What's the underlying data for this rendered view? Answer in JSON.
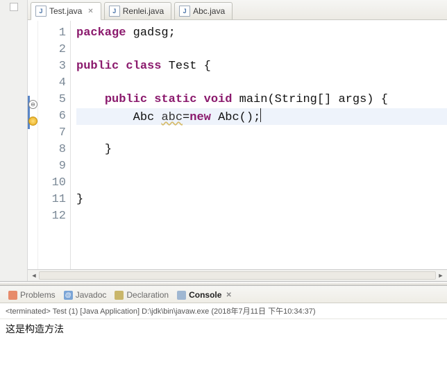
{
  "tabs": [
    {
      "label": "Test.java",
      "active": true,
      "closable": true
    },
    {
      "label": "Renlei.java",
      "active": false,
      "closable": false
    },
    {
      "label": "Abc.java",
      "active": false,
      "closable": false
    }
  ],
  "code": {
    "lines": [
      {
        "n": "1",
        "segments": [
          {
            "t": "package ",
            "c": "kw"
          },
          {
            "t": "gadsg;",
            "c": "plain"
          }
        ]
      },
      {
        "n": "2",
        "segments": []
      },
      {
        "n": "3",
        "segments": [
          {
            "t": "public class ",
            "c": "kw"
          },
          {
            "t": "Test {",
            "c": "plain"
          }
        ]
      },
      {
        "n": "4",
        "segments": []
      },
      {
        "n": "5",
        "prefix": "    ",
        "foldmark": true,
        "bluebar": true,
        "segments": [
          {
            "t": "public static void ",
            "c": "kw"
          },
          {
            "t": "main(String[] args) {",
            "c": "plain"
          }
        ]
      },
      {
        "n": "6",
        "prefix": "        ",
        "highlight": true,
        "warn": true,
        "bluebar": true,
        "segments": [
          {
            "t": "Abc ",
            "c": "plain"
          },
          {
            "t": "abc",
            "c": "err"
          },
          {
            "t": "=",
            "c": "plain"
          },
          {
            "t": "new ",
            "c": "kw"
          },
          {
            "t": "Abc();",
            "c": "plain"
          }
        ],
        "caret": true
      },
      {
        "n": "7",
        "segments": []
      },
      {
        "n": "8",
        "prefix": "    ",
        "segments": [
          {
            "t": "}",
            "c": "plain"
          }
        ]
      },
      {
        "n": "9",
        "segments": []
      },
      {
        "n": "10",
        "segments": []
      },
      {
        "n": "11",
        "segments": [
          {
            "t": "}",
            "c": "plain"
          }
        ]
      },
      {
        "n": "12",
        "segments": []
      }
    ],
    "fold_glyph": "⊖"
  },
  "views": [
    {
      "label": "Problems",
      "active": false,
      "iconColor": "#e78b6a"
    },
    {
      "label": "Javadoc",
      "active": false,
      "iconColor": "#7aa4d6",
      "iconText": "@"
    },
    {
      "label": "Declaration",
      "active": false,
      "iconColor": "#c9b66a"
    },
    {
      "label": "Console",
      "active": true,
      "iconColor": "#9fb7d2",
      "closable": true
    }
  ],
  "console": {
    "status": "<terminated> Test (1) [Java Application] D:\\jdk\\bin\\javaw.exe (2018年7月11日 下午10:34:37)",
    "output": "这是构造方法"
  }
}
